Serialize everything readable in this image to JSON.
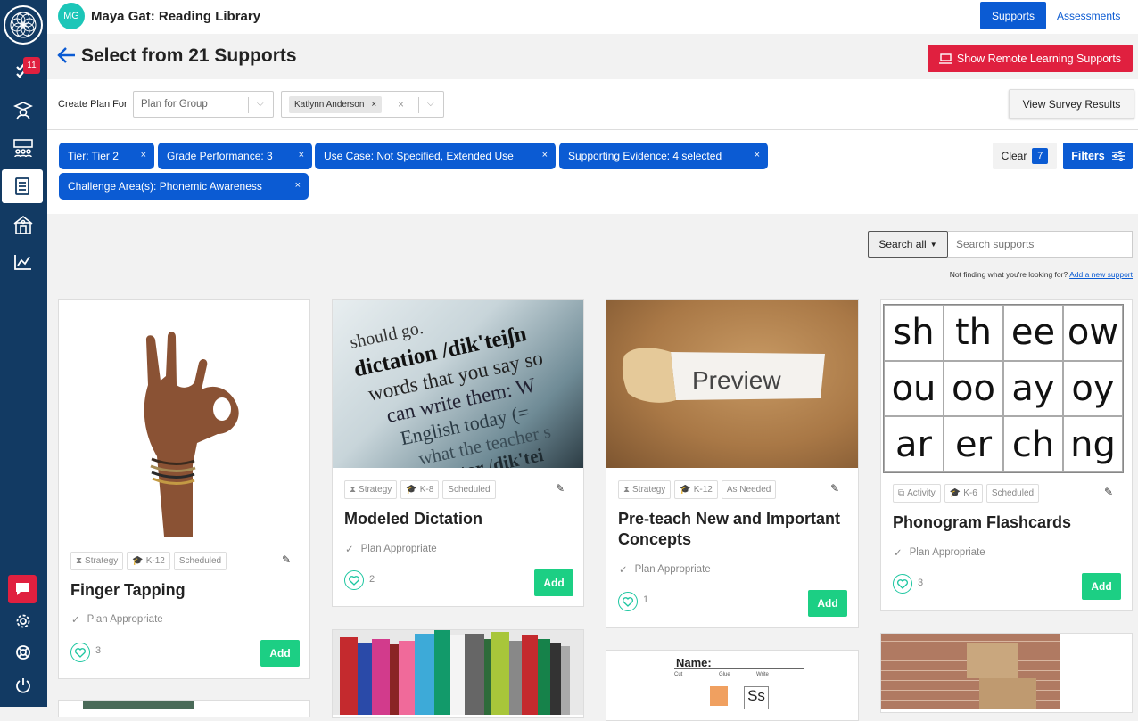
{
  "sidebar": {
    "notification_count": "11",
    "icons": [
      "tasks-icon",
      "graduate-icon",
      "classroom-icon",
      "book-icon",
      "school-icon",
      "chart-icon",
      "chat-icon",
      "gear-icon",
      "help-icon",
      "power-icon"
    ]
  },
  "topbar": {
    "avatar_initials": "MG",
    "title": "Maya Gat: Reading Library",
    "supports_label": "Supports",
    "assessments_label": "Assessments"
  },
  "header": {
    "title": "Select from 21 Supports",
    "remote_label": "Show Remote Learning Supports"
  },
  "plan": {
    "label": "Create Plan For",
    "group_value": "Plan for Group",
    "student_chip": "Katlynn Anderson",
    "survey_label": "View Survey Results"
  },
  "filters": {
    "pills": [
      "Tier: Tier 2",
      "Grade Performance: 3",
      "Use Case: Not Specified, Extended Use",
      "Supporting Evidence: 4 selected",
      "Challenge Area(s): Phonemic Awareness"
    ],
    "clear_label": "Clear",
    "clear_count": "7",
    "filters_label": "Filters"
  },
  "search": {
    "dropdown_label": "Search all",
    "placeholder": "Search supports",
    "not_finding": "Not finding what you're looking for?",
    "add_new_link": "Add a new support"
  },
  "cards": [
    {
      "title": "Finger Tapping",
      "tags": [
        "Strategy",
        "K-12",
        "Scheduled"
      ],
      "plan": "Plan Appropriate",
      "likes": "3",
      "add": "Add"
    },
    {
      "title": "Modeled Dictation",
      "tags": [
        "Strategy",
        "K-8",
        "Scheduled"
      ],
      "plan": "Plan Appropriate",
      "likes": "2",
      "add": "Add",
      "image_text": [
        "should go.",
        "dictation /dik'teiʃn",
        "words that you say so",
        "can write them: W",
        "English today (=",
        "what the teacher s",
        "ictator /dik'tei"
      ]
    },
    {
      "title": "Pre-teach New and Important Concepts",
      "tags": [
        "Strategy",
        "K-12",
        "As Needed"
      ],
      "plan": "Plan Appropriate",
      "likes": "1",
      "add": "Add",
      "image_text": "Preview"
    },
    {
      "title": "Phonogram Flashcards",
      "tags": [
        "Activity",
        "K-6",
        "Scheduled"
      ],
      "plan": "Plan Appropriate",
      "likes": "3",
      "add": "Add",
      "phonograms": [
        "sh",
        "th",
        "ee",
        "ow",
        "ou",
        "oo",
        "ay",
        "oy",
        "ar",
        "er",
        "ch",
        "ng"
      ]
    }
  ],
  "worksheet": {
    "name_label": "Name:",
    "cut": "Cut",
    "glue": "Glue",
    "write": "Write",
    "letters": "Ss"
  },
  "colors": {
    "sidebar": "#123a63",
    "primary": "#0b5bd3",
    "danger": "#e0203f",
    "add": "#1ccf84",
    "teal": "#1cc6b8"
  }
}
